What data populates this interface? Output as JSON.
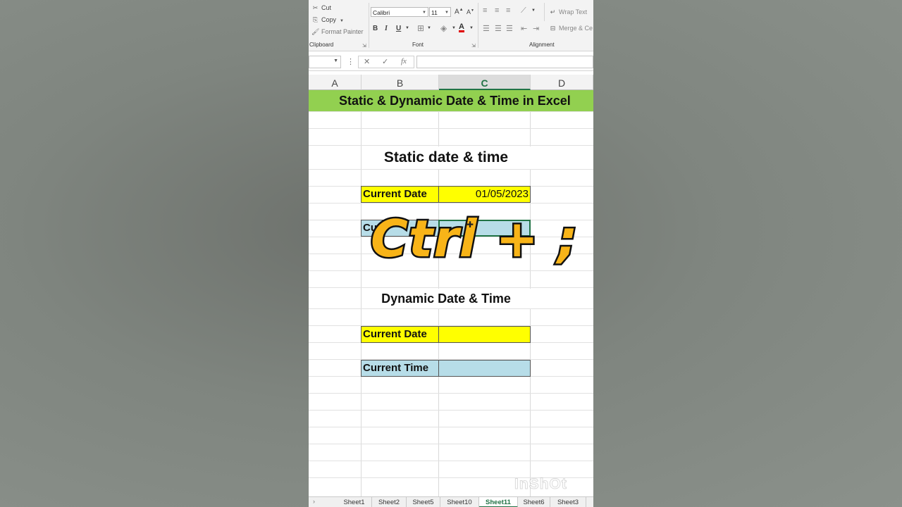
{
  "ribbon": {
    "clipboard": {
      "cut": "Cut",
      "copy": "Copy",
      "format_painter": "Format Painter",
      "group_label": "Clipboard"
    },
    "font": {
      "font_name": "Calibri",
      "font_size": "11",
      "bold": "B",
      "italic": "I",
      "underline": "U",
      "grow": "A",
      "shrink": "A",
      "color_letter": "A",
      "group_label": "Font"
    },
    "alignment": {
      "wrap_text": "Wrap Text",
      "merge": "Merge & Ce",
      "group_label": "Alignment"
    }
  },
  "formula_bar": {
    "fx": "fx",
    "cancel": "✕",
    "enter": "✓",
    "menu": "⋮",
    "value": ""
  },
  "columns": [
    "A",
    "B",
    "C",
    "D"
  ],
  "selected_column": "C",
  "banner": "Static & Dynamic Date & Time in Excel",
  "static_section": {
    "heading": "Static date & time",
    "date_label": "Current Date",
    "date_value": "01/05/2023",
    "time_label": "Current Time",
    "time_label_visible_left": "Cu",
    "time_label_visible_right": "e"
  },
  "dynamic_section": {
    "heading": "Dynamic Date & Time",
    "date_label": "Current Date",
    "date_value": "",
    "time_label": "Current Time",
    "time_value": ""
  },
  "overlay": {
    "shortcut": "Ctrl + ;"
  },
  "watermark": "InShOt",
  "sheet_tabs": [
    "Sheet1",
    "Sheet2",
    "Sheet5",
    "Sheet10",
    "Sheet11",
    "Sheet6",
    "Sheet3"
  ],
  "active_sheet": "Sheet11",
  "colors": {
    "banner": "#92d050",
    "yellow": "#ffff00",
    "blue": "#b7dde8",
    "overlay_fill": "#f8b418",
    "excel_green": "#217346"
  }
}
